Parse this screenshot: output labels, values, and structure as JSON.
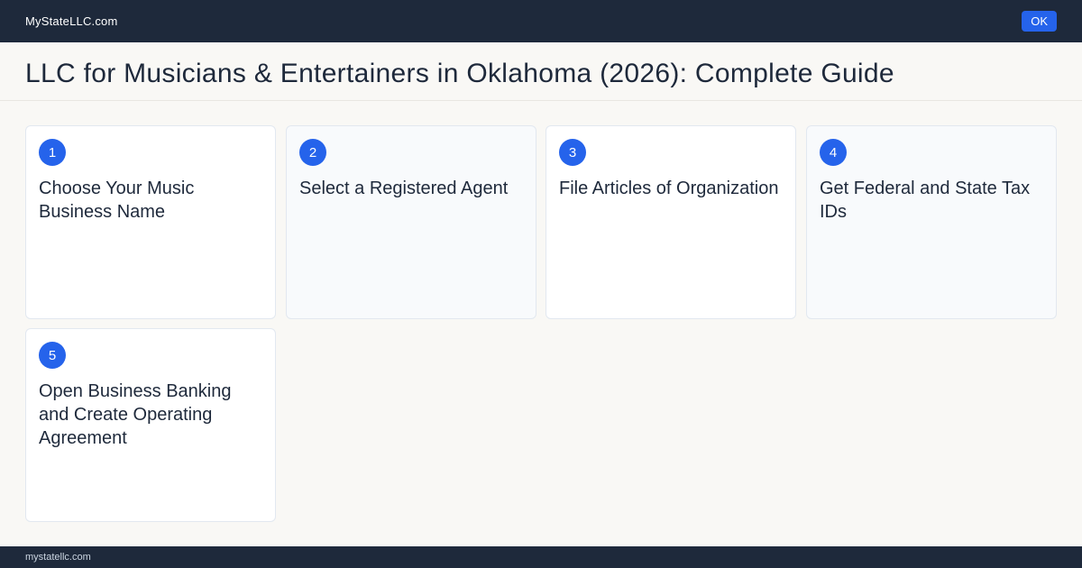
{
  "topbar": {
    "brand": "MyStateLLC.com",
    "ok_label": "OK"
  },
  "page": {
    "title": "LLC for Musicians & Entertainers  in Oklahoma (2026): Complete Guide"
  },
  "steps": [
    {
      "number": "1",
      "title": "Choose Your Music Business Name"
    },
    {
      "number": "2",
      "title": "Select a Registered Agent"
    },
    {
      "number": "3",
      "title": "File Articles of Organization"
    },
    {
      "number": "4",
      "title": "Get Federal and State Tax IDs"
    },
    {
      "number": "5",
      "title": "Open Business Banking and Create Operating Agreement"
    }
  ],
  "footer": {
    "text": "mystatellc.com"
  },
  "colors": {
    "header_bg": "#1e293b",
    "accent": "#2563eb",
    "page_bg": "#f9f8f5"
  }
}
